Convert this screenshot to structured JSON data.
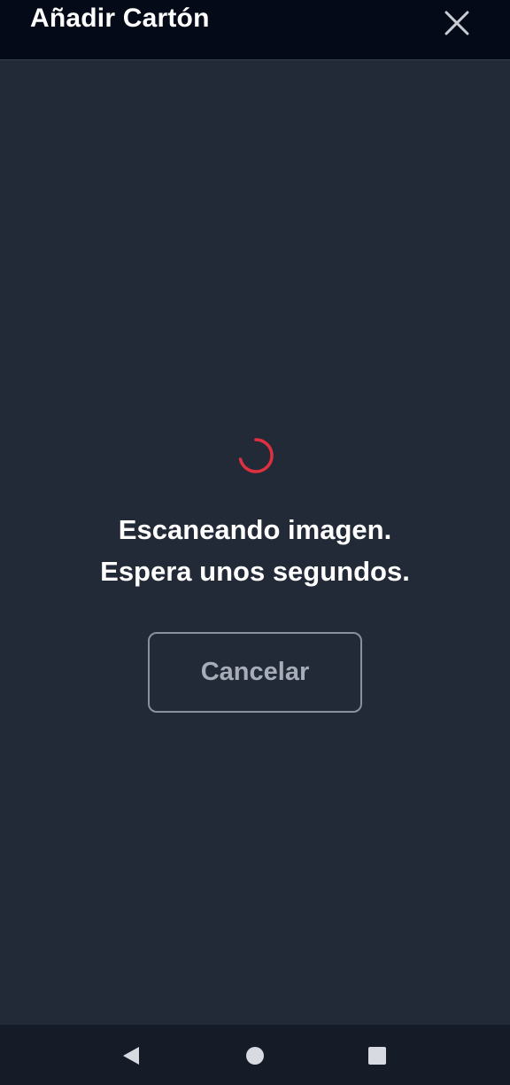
{
  "header": {
    "title": "Añadir Cartón",
    "close_icon": "close-icon"
  },
  "status": {
    "line1": "Escaneando imagen.",
    "line2": "Espera unos segundos."
  },
  "actions": {
    "cancel_label": "Cancelar"
  },
  "navbar": {
    "icons": [
      "back-triangle-icon",
      "home-circle-icon",
      "recents-square-icon"
    ]
  },
  "colors": {
    "background": "#222a38",
    "header_background": "#050a18",
    "spinner": "#e0303f",
    "navbar_background": "#151c28"
  }
}
